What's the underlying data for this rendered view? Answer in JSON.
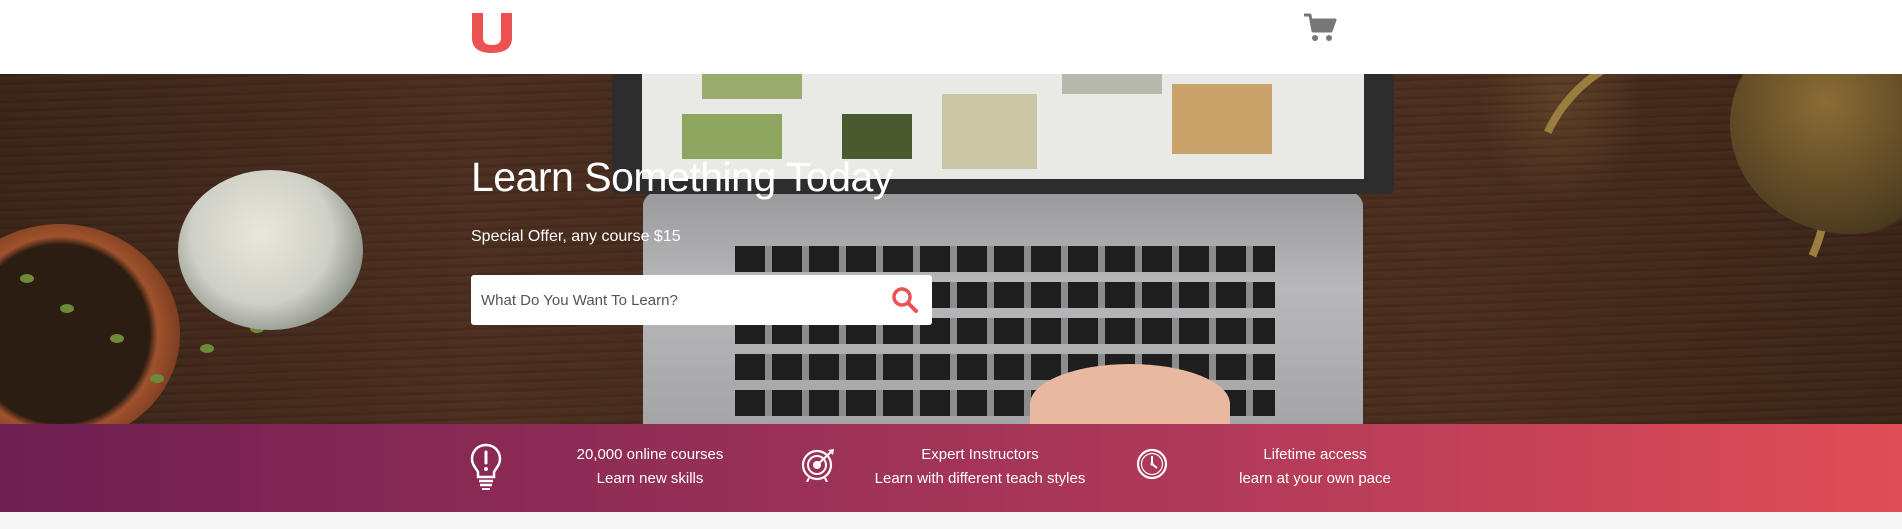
{
  "header": {
    "logo_icon": "udemy-u-logo",
    "logo_color": "#ec5252",
    "cart_icon": "cart-icon"
  },
  "hero": {
    "title": "Learn Something Today",
    "subtitle": "Special Offer, any course $15",
    "search": {
      "placeholder": "What Do You Want To Learn?",
      "value": "",
      "button_icon": "search-icon"
    }
  },
  "features": {
    "gradient": [
      "#6e1f52",
      "#e04d56"
    ],
    "items": [
      {
        "icon": "lightbulb-icon",
        "line1": "20,000 online courses",
        "line2": "Learn new skills"
      },
      {
        "icon": "target-icon",
        "line1": "Expert Instructors",
        "line2": "Learn with different teach styles"
      },
      {
        "icon": "clock-icon",
        "line1": "Lifetime access",
        "line2": "learn at your own pace"
      }
    ]
  }
}
